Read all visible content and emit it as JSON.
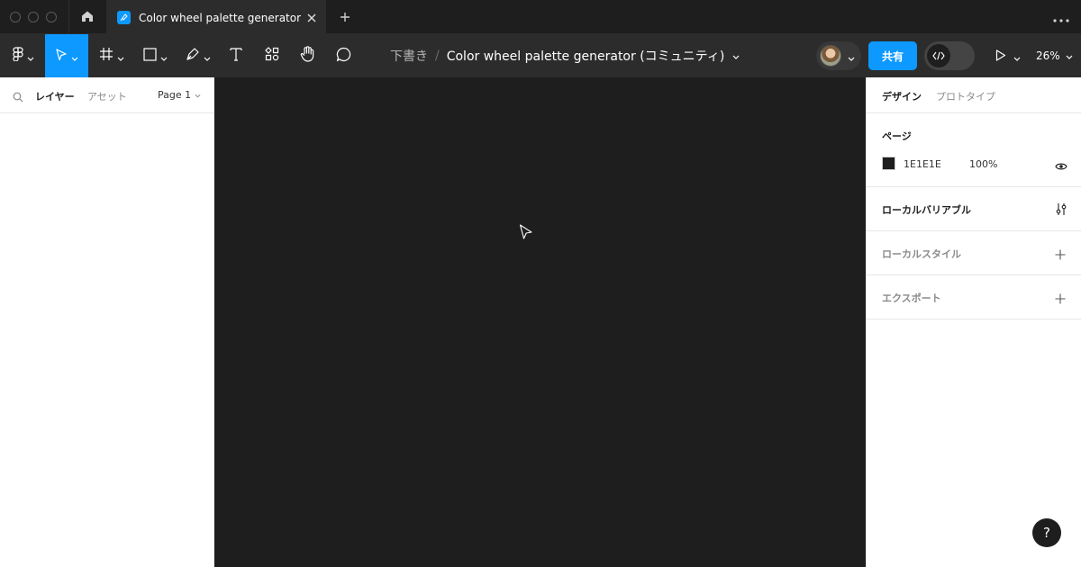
{
  "titlebar": {
    "tab_title": "Color wheel palette generator (コミ",
    "home_icon": "home-icon",
    "close_icon": "close-icon",
    "new_tab_icon": "plus-icon",
    "more_icon": "more-icon"
  },
  "toolbar": {
    "breadcrumb_drafts": "下書き",
    "breadcrumb_sep": "/",
    "file_name": "Color wheel palette generator (コミュニティ)",
    "share_label": "共有",
    "zoom": "26%",
    "accent_color": "#0d99ff",
    "tools": [
      "figma-menu-icon",
      "move-icon",
      "frame-icon",
      "rectangle-icon",
      "pen-icon",
      "text-icon",
      "resources-icon",
      "hand-icon",
      "comment-icon"
    ]
  },
  "left_panel": {
    "tab_layers": "レイヤー",
    "tab_assets": "アセット",
    "page": "Page 1"
  },
  "right_panel": {
    "tab_design": "デザイン",
    "tab_prototype": "プロトタイプ",
    "page_section": {
      "title": "ページ",
      "color_hex": "1E1E1E",
      "opacity": "100%",
      "swatch_color": "#1e1e1e"
    },
    "local_variables": "ローカルバリアブル",
    "local_styles": "ローカルスタイル",
    "export": "エクスポート",
    "help": "?"
  }
}
